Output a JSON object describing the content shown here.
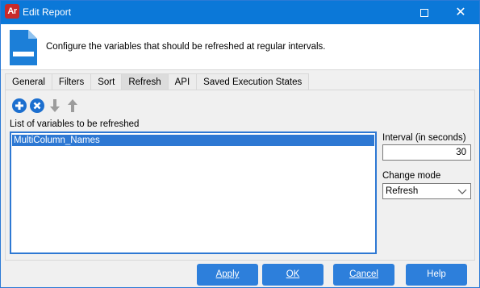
{
  "window": {
    "app_icon_text": "Ar",
    "title": "Edit Report"
  },
  "header": {
    "description": "Configure the variables that should be refreshed at regular intervals."
  },
  "tabs": [
    {
      "label": "General"
    },
    {
      "label": "Filters"
    },
    {
      "label": "Sort"
    },
    {
      "label": "Refresh"
    },
    {
      "label": "API"
    },
    {
      "label": "Saved Execution States"
    }
  ],
  "active_tab": "Refresh",
  "toolbar": {
    "icons": [
      "add-icon",
      "remove-icon",
      "move-down-icon",
      "move-up-icon"
    ]
  },
  "variables": {
    "label": "List of variables to be refreshed",
    "items": [
      "MultiColumn_Names"
    ]
  },
  "interval": {
    "label": "Interval (in seconds)",
    "value": "30"
  },
  "change_mode": {
    "label": "Change mode",
    "selected": "Refresh"
  },
  "buttons": {
    "apply": "Apply",
    "ok": "OK",
    "cancel": "Cancel",
    "help": "Help"
  },
  "colors": {
    "title_bar": "#0b78d8",
    "accent": "#2d7fdb",
    "selection": "#2d78d3"
  }
}
